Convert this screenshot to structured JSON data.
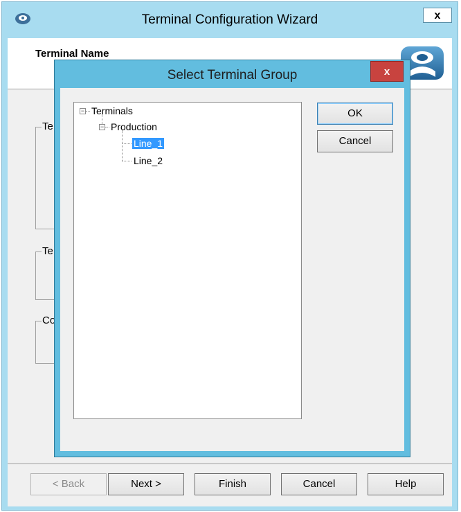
{
  "wizard": {
    "title": "Terminal Configuration Wizard",
    "close_label": "x",
    "header_title": "Terminal Name",
    "group_labels": [
      "Te",
      "Te",
      "Co"
    ],
    "buttons": {
      "back": "< Back",
      "next": "Next >",
      "finish": "Finish",
      "cancel": "Cancel",
      "help": "Help"
    }
  },
  "dialog": {
    "title": "Select Terminal Group",
    "close_label": "x",
    "tree": {
      "root": "Terminals",
      "child": "Production",
      "leaves": [
        "Line_1",
        "Line_2"
      ],
      "selected": "Line_1"
    },
    "ok_label": "OK",
    "cancel_label": "Cancel"
  },
  "colors": {
    "title_bar": "#a8dcf0",
    "dialog_frame": "#62bddf",
    "dialog_close": "#c8433f",
    "selection": "#3399ff"
  }
}
